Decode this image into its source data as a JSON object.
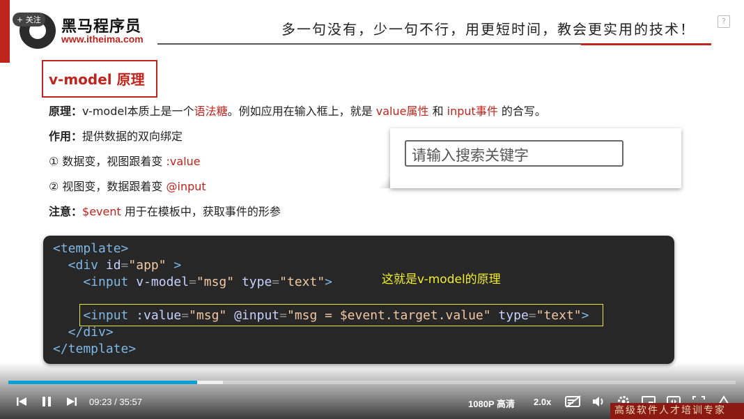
{
  "header": {
    "follow_label": "+ 关注",
    "brand": "黑马程序员",
    "url": "www.itheima.com",
    "slogan": "多一句没有，少一句不行，用更短时间，教会更实用的技术！",
    "help": "?"
  },
  "slide": {
    "title_a": "v-model ",
    "title_b": "原理",
    "lines": {
      "principle_label": "原理：",
      "principle_a": "v-model本质上是一个",
      "principle_sugar": "语法糖",
      "principle_b": "。例如应用在输入框上，就是 ",
      "principle_value": "value属性",
      "principle_c": " 和 ",
      "principle_input": "input事件",
      "principle_d": " 的合写。",
      "role_label": "作用：",
      "role_text": "提供数据的双向绑定",
      "item1_a": "① 数据变，视图跟着变 ",
      "item1_b": ":value",
      "item2_a": "② 视图变，数据跟着变 ",
      "item2_b": "@input",
      "note_label": "注意：",
      "note_event": "$event",
      "note_text": " 用于在模板中，获取事件的形参"
    },
    "input_placeholder": "请输入搜索关键字",
    "code": {
      "l1": "<template>",
      "l2_a": "  <div ",
      "l2_attr": "id",
      "l2_eq": "=",
      "l2_str": "\"app\"",
      "l2_b": " >",
      "l3_a": "    <input ",
      "l3_attr1": "v-model",
      "l3_str1": "\"msg\"",
      "l3_attr2": " type",
      "l3_str2": "\"text\"",
      "l3_b": ">",
      "l5_a": "    <input ",
      "l5_attr1": ":value",
      "l5_str1": "\"msg\"",
      "l5_attr2": " @input",
      "l5_str2": "\"msg = $event.target.value\"",
      "l5_attr3": " type",
      "l5_str3": "\"text\"",
      "l5_b": ">",
      "l6": "  </div>",
      "l7": "</template>",
      "note": "这就是v-model的原理"
    }
  },
  "player": {
    "current_time": "09:23",
    "separator": "/",
    "total_time": "35:57",
    "quality": "1080P 高清",
    "speed": "2.0x",
    "progress": 0.26,
    "buffered": 0.295,
    "accent": "#00a1d6",
    "watermark": "高级软件人才培训专家"
  }
}
